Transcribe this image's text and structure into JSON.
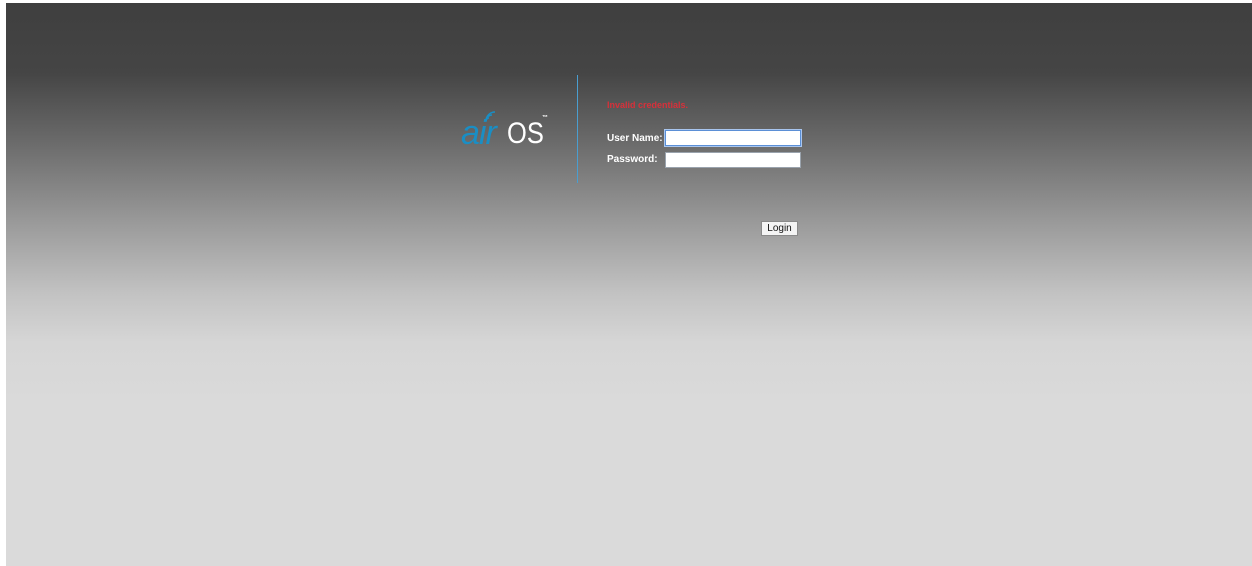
{
  "logo": {
    "air_text": "air",
    "os_text": "OS",
    "trademark": "™",
    "air_color": "#1a8ec4",
    "os_color": "#ffffff"
  },
  "login": {
    "error_message": "Invalid credentials.",
    "error_color": "#d8303a",
    "username_label": "User Name:",
    "username_value": "",
    "password_label": "Password:",
    "password_value": "",
    "login_button_label": "Login"
  },
  "theme": {
    "background_top": "#3f3f3f",
    "background_bottom": "#dadada",
    "divider_color": "#4a9ed0"
  }
}
